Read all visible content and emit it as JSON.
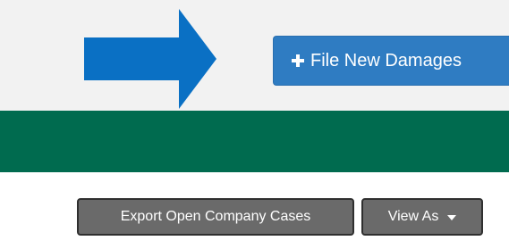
{
  "header": {
    "file_button_label": "File New Damages",
    "file_button_icon": "plus-icon",
    "arrow_icon": "right-arrow-icon",
    "arrow_color": "#0a70c4",
    "button_color": "#2f7cc2"
  },
  "banner": {
    "color": "#006b4f"
  },
  "toolbar": {
    "export_label": "Export Open Company Cases",
    "view_as_label": "View As",
    "view_as_icon": "caret-down-icon",
    "button_color": "#6a6a6a"
  }
}
